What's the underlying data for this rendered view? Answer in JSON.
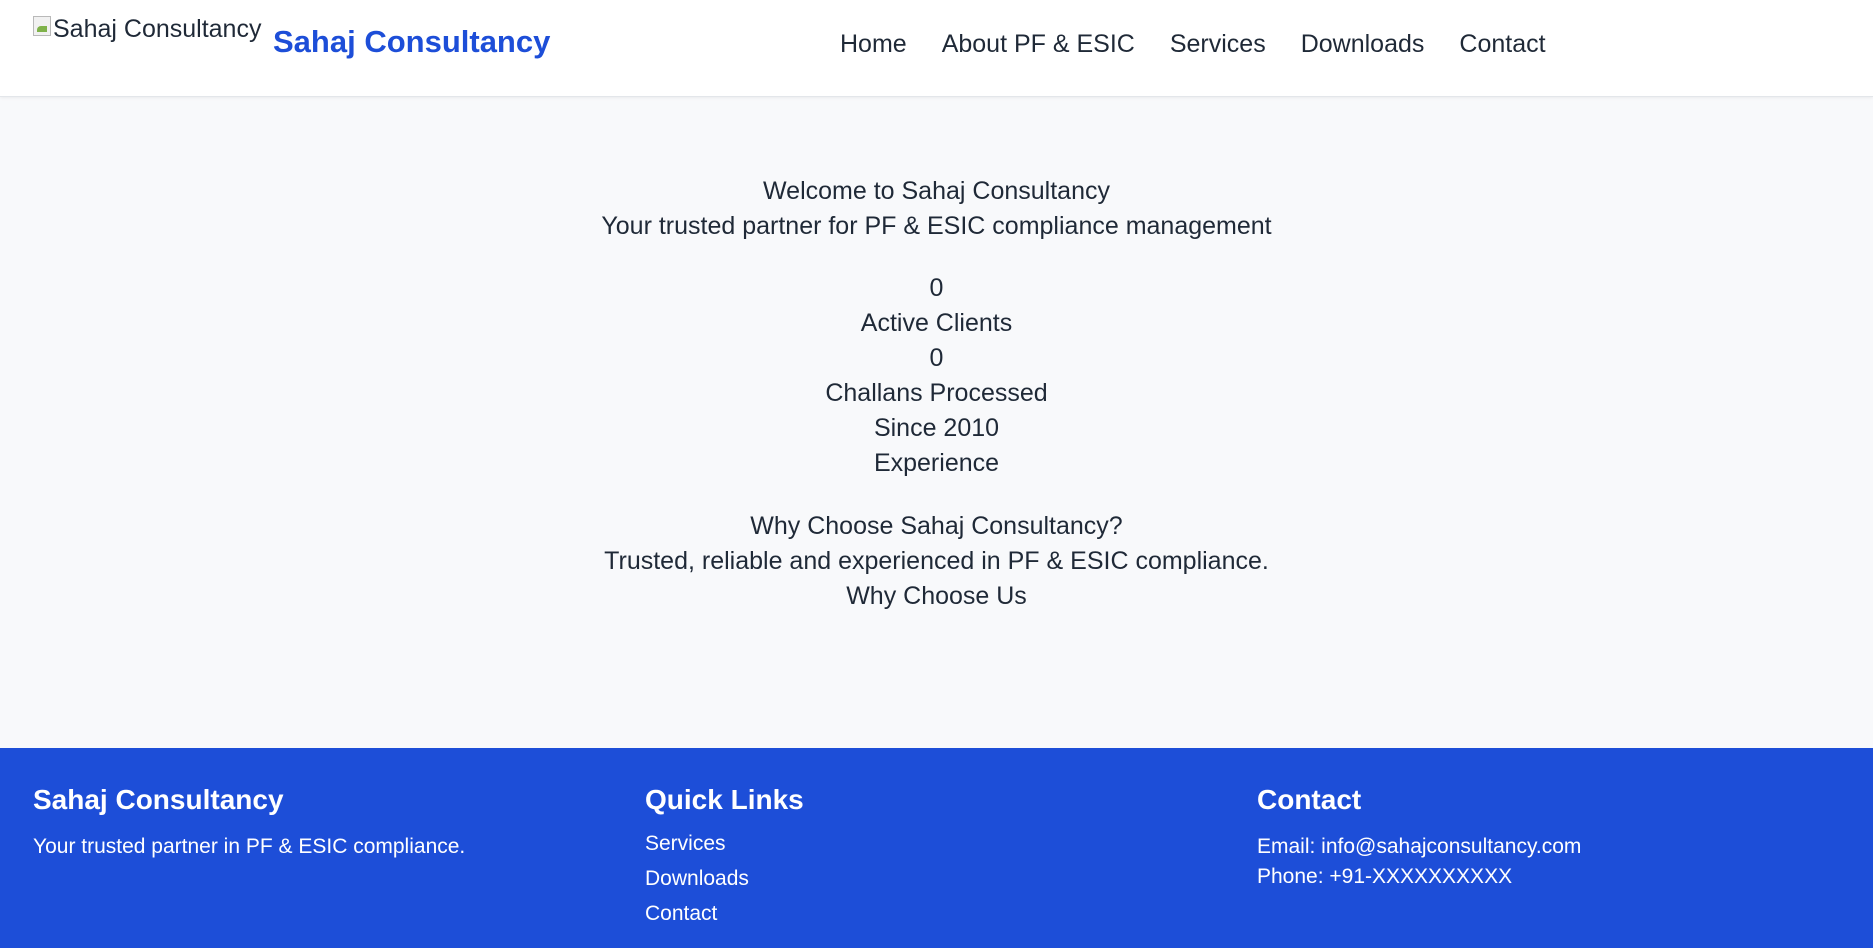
{
  "header": {
    "logo_alt": "Sahaj Consultancy",
    "brand": "Sahaj Consultancy",
    "nav": [
      "Home",
      "About PF & ESIC",
      "Services",
      "Downloads",
      "Contact"
    ]
  },
  "hero": {
    "title": "Welcome to Sahaj Consultancy",
    "subtitle": "Your trusted partner for PF & ESIC compliance management"
  },
  "stats": [
    {
      "value": "0",
      "label": "Active Clients"
    },
    {
      "value": "0",
      "label": "Challans Processed"
    },
    {
      "value": "Since 2010",
      "label": "Experience"
    }
  ],
  "why": {
    "title": "Why Choose Sahaj Consultancy?",
    "text": "Trusted, reliable and experienced in PF & ESIC compliance.",
    "label": "Why Choose Us"
  },
  "footer": {
    "about": {
      "title": "Sahaj Consultancy",
      "text": "Your trusted partner in PF & ESIC compliance."
    },
    "links": {
      "title": "Quick Links",
      "items": [
        "Services",
        "Downloads",
        "Contact"
      ]
    },
    "contact": {
      "title": "Contact",
      "email": "Email: info@sahajconsultancy.com",
      "phone": "Phone: +91-XXXXXXXXXX"
    }
  },
  "colors": {
    "brand": "#1d4ed8",
    "text": "#1f2937",
    "background": "#f8f9fb"
  }
}
